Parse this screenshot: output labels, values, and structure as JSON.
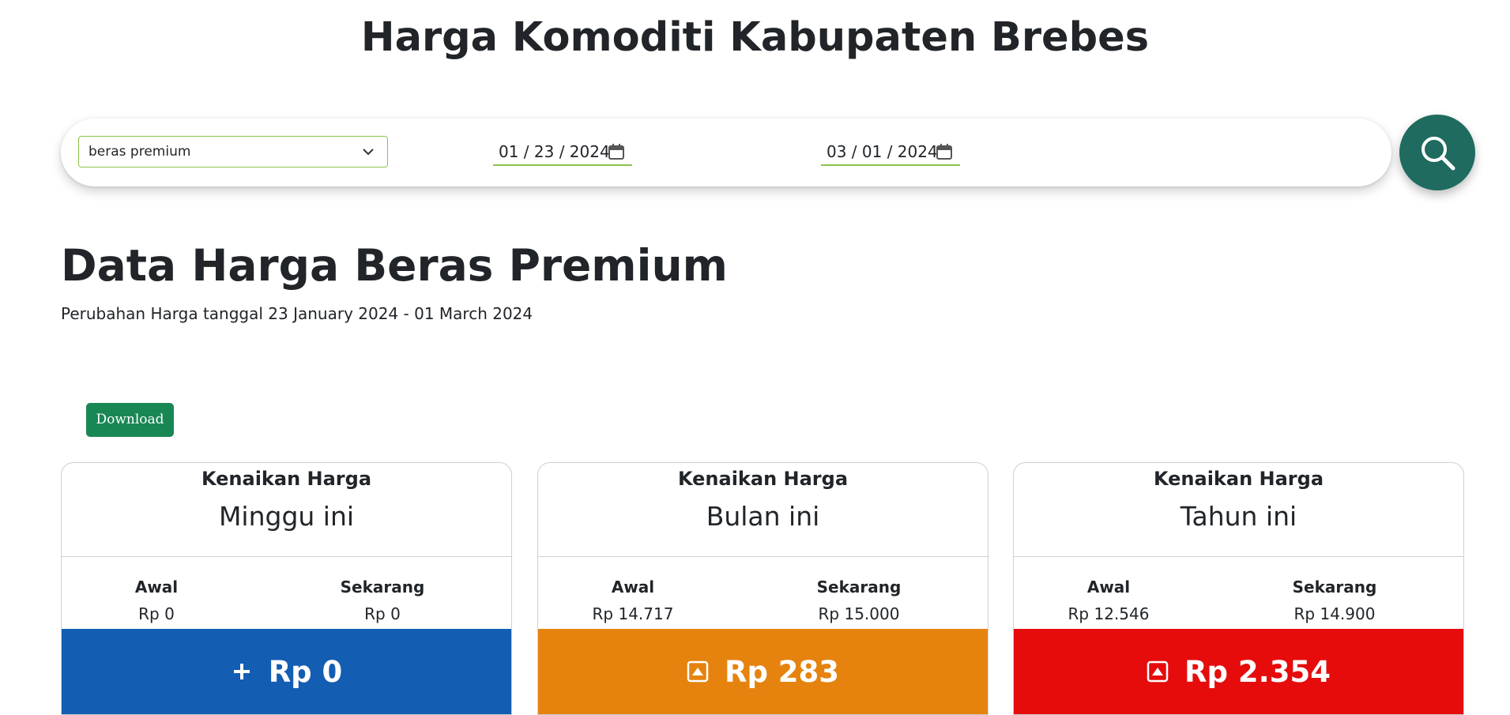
{
  "header": {
    "title": "Harga Komoditi Kabupaten Brebes"
  },
  "filter": {
    "commodity": "beras premium",
    "date_start": "01 / 23 / 2024",
    "date_end": "03 / 01 / 2024"
  },
  "main": {
    "title": "Data Harga Beras Premium",
    "subtitle": "Perubahan Harga tanggal 23 January 2024 - 01 March 2024",
    "download_label": "Download"
  },
  "colors": {
    "accent": "#1f6b5f",
    "field_border": "#8bc34a",
    "download": "#198754"
  },
  "cards": [
    {
      "kicker": "Kenaikan Harga",
      "period": "Minggu ini",
      "awal_label": "Awal",
      "now_label": "Sekarang",
      "awal": "Rp 0",
      "now": "Rp 0",
      "change": "Rp 0",
      "change_icon": "plus-icon",
      "color": "#135db3"
    },
    {
      "kicker": "Kenaikan Harga",
      "period": "Bulan ini",
      "awal_label": "Awal",
      "now_label": "Sekarang",
      "awal": "Rp 14.717",
      "now": "Rp 15.000",
      "change": "Rp 283",
      "change_icon": "caret-up-square-icon",
      "color": "#e5830e"
    },
    {
      "kicker": "Kenaikan Harga",
      "period": "Tahun ini",
      "awal_label": "Awal",
      "now_label": "Sekarang",
      "awal": "Rp 12.546",
      "now": "Rp 14.900",
      "change": "Rp 2.354",
      "change_icon": "caret-up-square-icon",
      "color": "#e60c0c"
    }
  ]
}
